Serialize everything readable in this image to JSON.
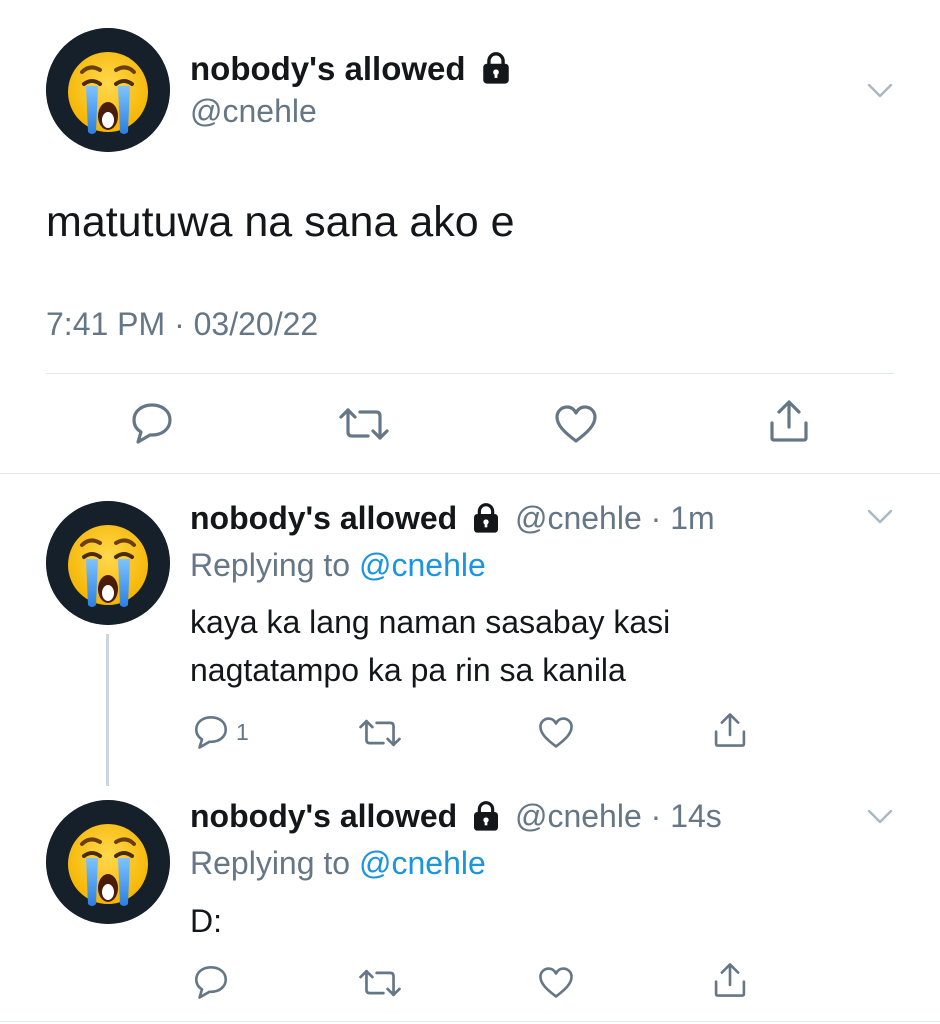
{
  "main_tweet": {
    "display_name": "nobody's allowed",
    "handle": "@cnehle",
    "text": "matutuwa na sana ako e",
    "timestamp": "7:41 PM · 03/20/22",
    "avatar_icon": "loudly-crying-face-icon",
    "lock_icon": "lock-icon"
  },
  "replies": [
    {
      "display_name": "nobody's allowed",
      "handle_time": "@cnehle · 1m",
      "replying_prefix": "Replying to",
      "replying_to": "@cnehle",
      "text_line1": "kaya ka lang naman sasabay kasi",
      "text_line2": "nagtatampo ka pa rin sa kanila",
      "reply_count": "1"
    },
    {
      "display_name": "nobody's allowed",
      "handle_time": "@cnehle · 14s",
      "replying_prefix": "Replying to",
      "replying_to": "@cnehle",
      "text_line1": "D:",
      "reply_count": ""
    }
  ],
  "colors": {
    "text": "#14171a",
    "muted": "#657786",
    "link": "#1b95e0",
    "divider": "#e1e8ed",
    "avatar_bg": "#15202b"
  }
}
